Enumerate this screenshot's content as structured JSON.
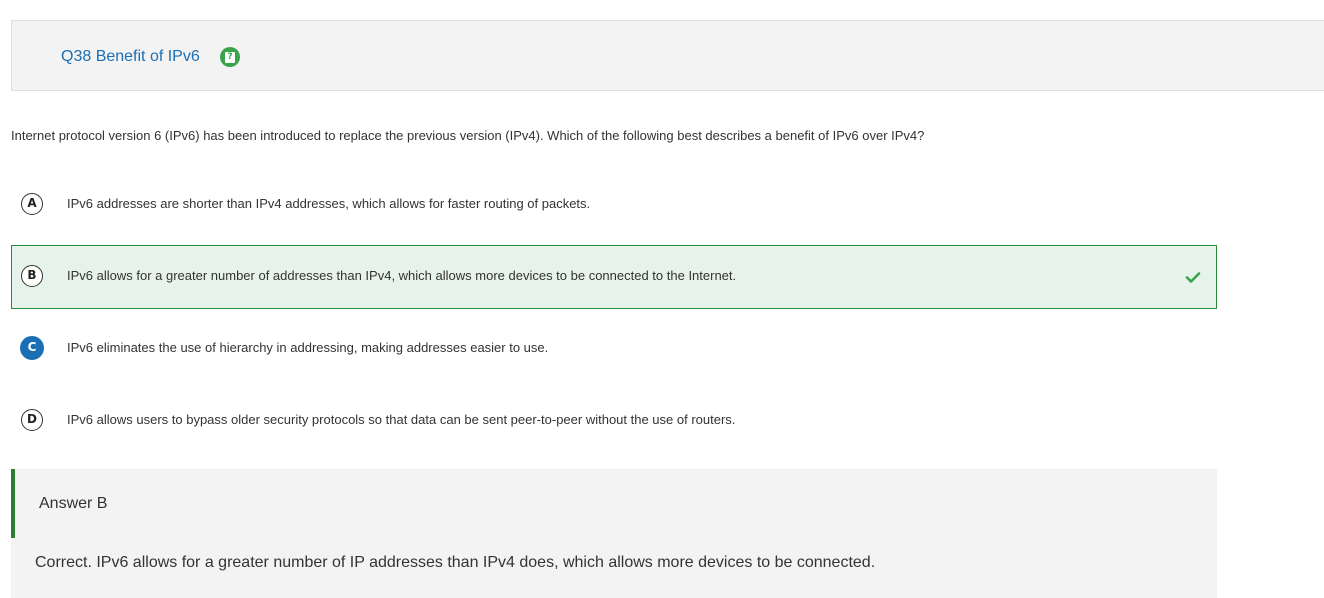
{
  "question": {
    "title": "Q38 Benefit of IPv6",
    "help_icon": "help-icon",
    "text": "Internet protocol version 6 (IPv6) has been introduced to replace the previous version (IPv4). Which of the following best describes a benefit of IPv6 over IPv4?"
  },
  "options": [
    {
      "letter": "A",
      "text": "IPv6 addresses are shorter than IPv4 addresses, which allows for faster routing of packets."
    },
    {
      "letter": "B",
      "text": "IPv6 allows for a greater number of addresses than IPv4, which allows more devices to be connected to the Internet.",
      "correct": true
    },
    {
      "letter": "C",
      "text": "IPv6 eliminates the use of hierarchy in addressing, making addresses easier to use.",
      "chosen": true
    },
    {
      "letter": "D",
      "text": "IPv6 allows users to bypass older security protocols so that data can be sent peer-to-peer without the use of routers."
    }
  ],
  "answer": {
    "label": "Answer B",
    "explanation": "Correct. IPv6 allows for a greater number of IP addresses than IPv4 does, which allows more devices to be connected."
  },
  "colors": {
    "title_blue": "#1a6fb5",
    "correct_green": "#2e8b3e",
    "correct_bg": "#e6f3ea",
    "panel_gray": "#f3f3f3"
  }
}
